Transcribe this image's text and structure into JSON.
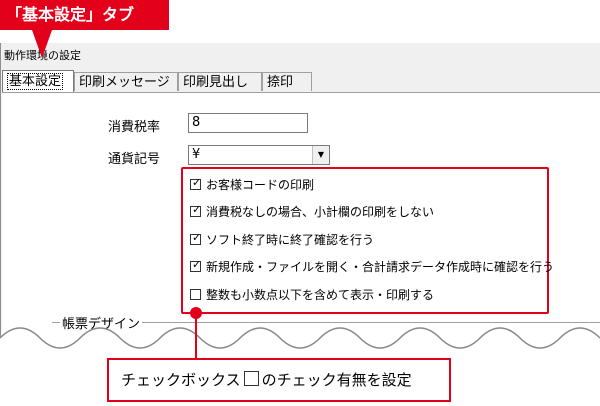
{
  "window": {
    "title": "動作環境の設定"
  },
  "tabs": [
    {
      "label": "基本設定"
    },
    {
      "label": "印刷メッセージ"
    },
    {
      "label": "印刷見出し"
    },
    {
      "label": "捺印"
    }
  ],
  "fields": {
    "tax_label": "消費税率",
    "tax_value": "8",
    "currency_label": "通貨記号",
    "currency_value": "¥"
  },
  "checkboxes": [
    {
      "label": "お客様コードの印刷",
      "checked": true
    },
    {
      "label": "消費税なしの場合、小計欄の印刷をしない",
      "checked": true
    },
    {
      "label": "ソフト終了時に終了確認を行う",
      "checked": true
    },
    {
      "label": "新規作成・ファイルを開く・合計請求データ作成時に確認を行う",
      "checked": true
    },
    {
      "label": "整数も小数点以下を含めて表示・印刷する",
      "checked": false
    }
  ],
  "groups": {
    "design_label": "帳票デザイン"
  },
  "annotations": {
    "top_callout": "「基本設定」タブ",
    "bottom_callout_before": "チェックボックス",
    "bottom_callout_after": "のチェック有無を設定"
  },
  "colors": {
    "accent_red": "#e3001b"
  }
}
